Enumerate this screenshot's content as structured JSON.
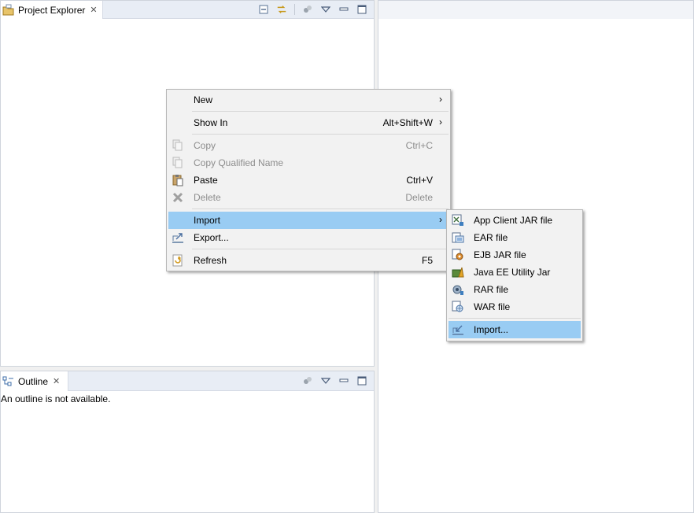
{
  "project_explorer": {
    "title": "Project Explorer",
    "close_glyph": "✕",
    "tools": [
      "collapse-all-icon",
      "link-with-editor-icon",
      "filters-icon",
      "view-menu-icon",
      "minimize-icon",
      "maximize-icon"
    ]
  },
  "outline": {
    "title": "Outline",
    "close_glyph": "✕",
    "message": "An outline is not available."
  },
  "context_menu": {
    "items": [
      {
        "label": "New",
        "shortcut": "",
        "submenu": true
      },
      {
        "label": "Show In",
        "shortcut": "Alt+Shift+W",
        "submenu": true
      },
      {
        "label": "Copy",
        "shortcut": "Ctrl+C",
        "disabled": true
      },
      {
        "label": "Copy Qualified Name",
        "shortcut": "",
        "disabled": true
      },
      {
        "label": "Paste",
        "shortcut": "Ctrl+V"
      },
      {
        "label": "Delete",
        "shortcut": "Delete",
        "disabled": true
      },
      {
        "label": "Import",
        "shortcut": "",
        "submenu": true,
        "highlighted": true
      },
      {
        "label": "Export...",
        "shortcut": ""
      },
      {
        "label": "Refresh",
        "shortcut": "F5"
      }
    ],
    "arrow_glyph": "›"
  },
  "import_submenu": {
    "items": [
      {
        "label": "App Client JAR file"
      },
      {
        "label": "EAR file"
      },
      {
        "label": "EJB JAR file"
      },
      {
        "label": "Java EE Utility Jar"
      },
      {
        "label": "RAR file"
      },
      {
        "label": "WAR file"
      },
      {
        "label": "Import...",
        "highlighted": true
      }
    ]
  },
  "colors": {
    "highlight": "#99ccf3",
    "tabbar": "#e8edf5",
    "disabled_text": "#8d8d8d"
  }
}
